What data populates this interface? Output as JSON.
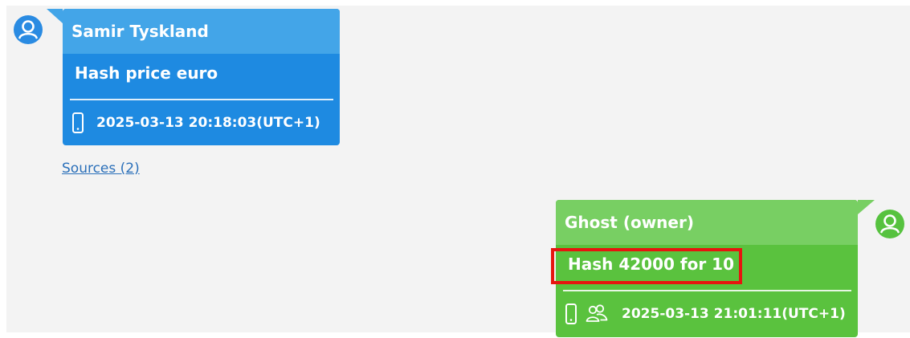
{
  "messages": [
    {
      "sender": "Samir Tyskland",
      "text": "Hash price euro",
      "timestamp": "2025-03-13 20:18:03(UTC+1)",
      "direction": "incoming",
      "icons": [
        "phone-icon"
      ],
      "color": "#1e8ae1"
    },
    {
      "sender": "Ghost (owner)",
      "text": "Hash 42000 for 10",
      "timestamp": "2025-03-13 21:01:11(UTC+1)",
      "direction": "outgoing",
      "icons": [
        "phone-icon",
        "group-icon"
      ],
      "color": "#5ac23e",
      "highlighted": true,
      "highlight_color": "#e6150f"
    }
  ],
  "sources_link": "Sources (2)"
}
